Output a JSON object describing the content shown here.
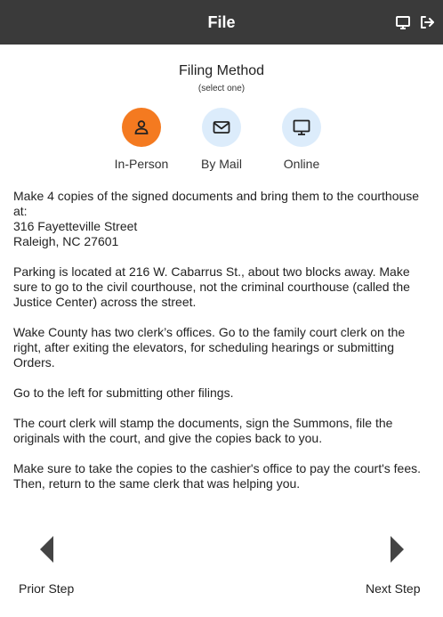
{
  "header": {
    "title": "File",
    "icons": [
      "monitor-icon",
      "logout-icon"
    ]
  },
  "filing": {
    "title": "Filing Method",
    "subtitle": "(select one)",
    "methods": [
      {
        "label": "In-Person",
        "icon": "person-icon",
        "selected": true
      },
      {
        "label": "By Mail",
        "icon": "mail-icon",
        "selected": false
      },
      {
        "label": "Online",
        "icon": "monitor-icon",
        "selected": false
      }
    ]
  },
  "colors": {
    "header_bg": "#3a3a3a",
    "selected_bg": "#f47a20",
    "unselected_bg": "#dcecfb"
  },
  "instructions": {
    "intro": "Make 4 copies of the signed documents and bring them to the courthouse at:",
    "address_line1": "316 Fayetteville Street",
    "address_line2": "Raleigh, NC 27601",
    "parking": "Parking is located at 216 W. Cabarrus St., about two blocks away. Make sure to go to the civil courthouse, not the criminal courthouse (called the Justice Center) across the street.",
    "clerks": "Wake County has two clerk’s offices. Go to the family court clerk on the right, after exiting the elevators, for scheduling hearings or submitting Orders.",
    "left": "Go to the left for submitting other filings.",
    "stamp": "The court clerk will stamp the documents, sign the Summons, file the originals with the court, and give the copies back to you.",
    "cashier": "Make sure to take the copies to the cashier's office to pay the court's fees. Then, return to the same clerk that was helping you."
  },
  "nav": {
    "prior_label": "Prior Step",
    "next_label": "Next Step"
  }
}
